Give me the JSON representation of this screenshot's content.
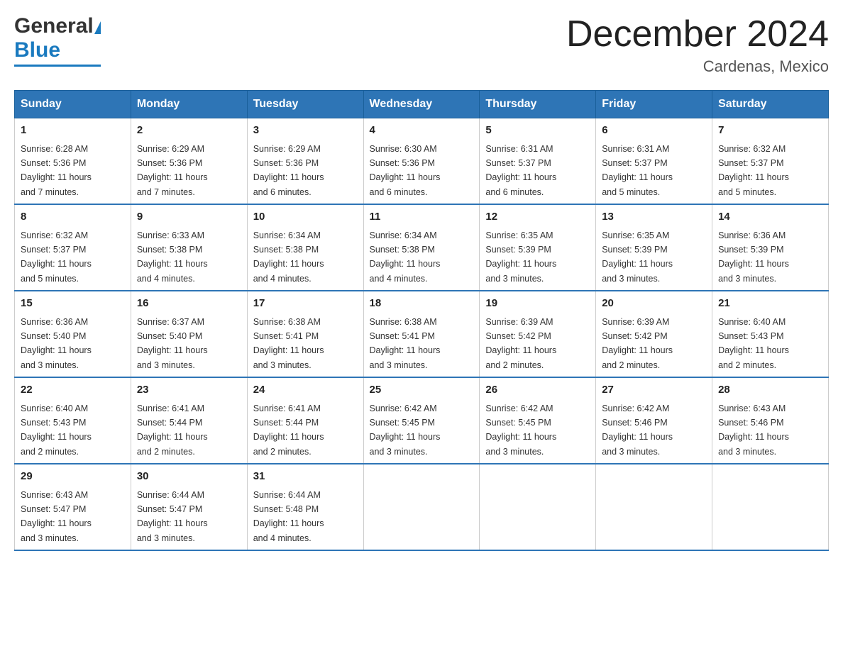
{
  "header": {
    "logo_general": "General",
    "logo_blue": "Blue",
    "month_title": "December 2024",
    "location": "Cardenas, Mexico"
  },
  "weekdays": [
    "Sunday",
    "Monday",
    "Tuesday",
    "Wednesday",
    "Thursday",
    "Friday",
    "Saturday"
  ],
  "weeks": [
    [
      {
        "day": "1",
        "sunrise": "6:28 AM",
        "sunset": "5:36 PM",
        "daylight": "11 hours and 7 minutes."
      },
      {
        "day": "2",
        "sunrise": "6:29 AM",
        "sunset": "5:36 PM",
        "daylight": "11 hours and 7 minutes."
      },
      {
        "day": "3",
        "sunrise": "6:29 AM",
        "sunset": "5:36 PM",
        "daylight": "11 hours and 6 minutes."
      },
      {
        "day": "4",
        "sunrise": "6:30 AM",
        "sunset": "5:36 PM",
        "daylight": "11 hours and 6 minutes."
      },
      {
        "day": "5",
        "sunrise": "6:31 AM",
        "sunset": "5:37 PM",
        "daylight": "11 hours and 6 minutes."
      },
      {
        "day": "6",
        "sunrise": "6:31 AM",
        "sunset": "5:37 PM",
        "daylight": "11 hours and 5 minutes."
      },
      {
        "day": "7",
        "sunrise": "6:32 AM",
        "sunset": "5:37 PM",
        "daylight": "11 hours and 5 minutes."
      }
    ],
    [
      {
        "day": "8",
        "sunrise": "6:32 AM",
        "sunset": "5:37 PM",
        "daylight": "11 hours and 5 minutes."
      },
      {
        "day": "9",
        "sunrise": "6:33 AM",
        "sunset": "5:38 PM",
        "daylight": "11 hours and 4 minutes."
      },
      {
        "day": "10",
        "sunrise": "6:34 AM",
        "sunset": "5:38 PM",
        "daylight": "11 hours and 4 minutes."
      },
      {
        "day": "11",
        "sunrise": "6:34 AM",
        "sunset": "5:38 PM",
        "daylight": "11 hours and 4 minutes."
      },
      {
        "day": "12",
        "sunrise": "6:35 AM",
        "sunset": "5:39 PM",
        "daylight": "11 hours and 3 minutes."
      },
      {
        "day": "13",
        "sunrise": "6:35 AM",
        "sunset": "5:39 PM",
        "daylight": "11 hours and 3 minutes."
      },
      {
        "day": "14",
        "sunrise": "6:36 AM",
        "sunset": "5:39 PM",
        "daylight": "11 hours and 3 minutes."
      }
    ],
    [
      {
        "day": "15",
        "sunrise": "6:36 AM",
        "sunset": "5:40 PM",
        "daylight": "11 hours and 3 minutes."
      },
      {
        "day": "16",
        "sunrise": "6:37 AM",
        "sunset": "5:40 PM",
        "daylight": "11 hours and 3 minutes."
      },
      {
        "day": "17",
        "sunrise": "6:38 AM",
        "sunset": "5:41 PM",
        "daylight": "11 hours and 3 minutes."
      },
      {
        "day": "18",
        "sunrise": "6:38 AM",
        "sunset": "5:41 PM",
        "daylight": "11 hours and 3 minutes."
      },
      {
        "day": "19",
        "sunrise": "6:39 AM",
        "sunset": "5:42 PM",
        "daylight": "11 hours and 2 minutes."
      },
      {
        "day": "20",
        "sunrise": "6:39 AM",
        "sunset": "5:42 PM",
        "daylight": "11 hours and 2 minutes."
      },
      {
        "day": "21",
        "sunrise": "6:40 AM",
        "sunset": "5:43 PM",
        "daylight": "11 hours and 2 minutes."
      }
    ],
    [
      {
        "day": "22",
        "sunrise": "6:40 AM",
        "sunset": "5:43 PM",
        "daylight": "11 hours and 2 minutes."
      },
      {
        "day": "23",
        "sunrise": "6:41 AM",
        "sunset": "5:44 PM",
        "daylight": "11 hours and 2 minutes."
      },
      {
        "day": "24",
        "sunrise": "6:41 AM",
        "sunset": "5:44 PM",
        "daylight": "11 hours and 2 minutes."
      },
      {
        "day": "25",
        "sunrise": "6:42 AM",
        "sunset": "5:45 PM",
        "daylight": "11 hours and 3 minutes."
      },
      {
        "day": "26",
        "sunrise": "6:42 AM",
        "sunset": "5:45 PM",
        "daylight": "11 hours and 3 minutes."
      },
      {
        "day": "27",
        "sunrise": "6:42 AM",
        "sunset": "5:46 PM",
        "daylight": "11 hours and 3 minutes."
      },
      {
        "day": "28",
        "sunrise": "6:43 AM",
        "sunset": "5:46 PM",
        "daylight": "11 hours and 3 minutes."
      }
    ],
    [
      {
        "day": "29",
        "sunrise": "6:43 AM",
        "sunset": "5:47 PM",
        "daylight": "11 hours and 3 minutes."
      },
      {
        "day": "30",
        "sunrise": "6:44 AM",
        "sunset": "5:47 PM",
        "daylight": "11 hours and 3 minutes."
      },
      {
        "day": "31",
        "sunrise": "6:44 AM",
        "sunset": "5:48 PM",
        "daylight": "11 hours and 4 minutes."
      },
      null,
      null,
      null,
      null
    ]
  ],
  "labels": {
    "sunrise": "Sunrise:",
    "sunset": "Sunset:",
    "daylight": "Daylight:"
  }
}
